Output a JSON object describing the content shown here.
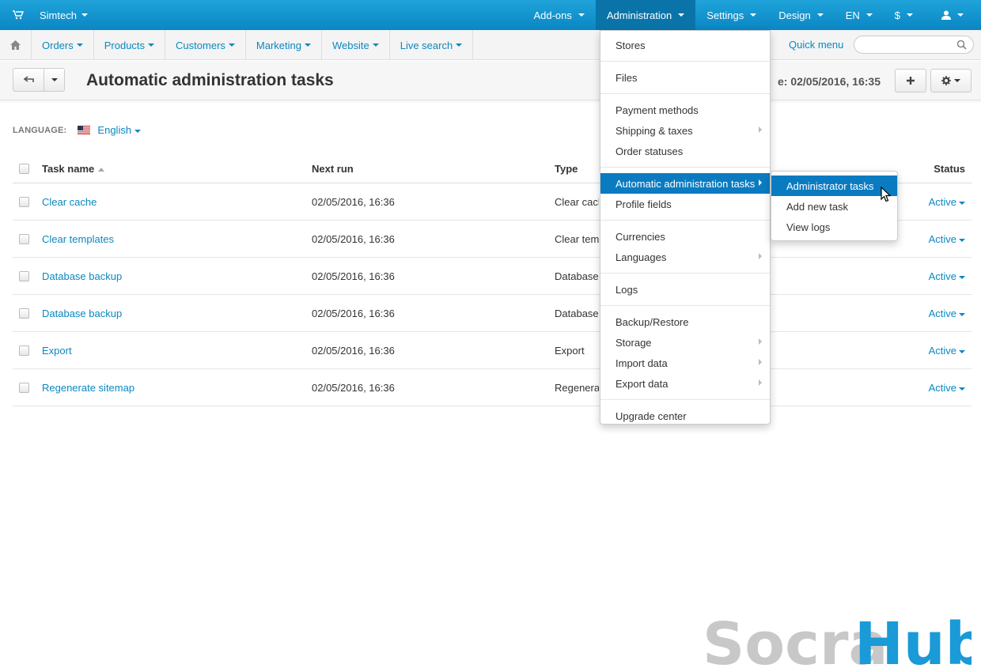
{
  "topbar": {
    "store_label": "Simtech",
    "nav": [
      "Add-ons",
      "Administration",
      "Settings",
      "Design",
      "EN",
      "$"
    ],
    "active_index": 1
  },
  "subnav": {
    "items": [
      "Orders",
      "Products",
      "Customers",
      "Marketing",
      "Website",
      "Live search"
    ],
    "quick_menu": "Quick menu",
    "search_placeholder": ""
  },
  "titlebar": {
    "title": "Automatic administration tasks",
    "current_time": "e: 02/05/2016, 16:35"
  },
  "language": {
    "label": "LANGUAGE:",
    "value": "English"
  },
  "table": {
    "headers": {
      "name": "Task name",
      "next_run": "Next run",
      "type": "Type",
      "status": "Status"
    },
    "rows": [
      {
        "name": "Clear cache",
        "next_run": "02/05/2016, 16:36",
        "type": "Clear cache",
        "status": "Active"
      },
      {
        "name": "Clear templates",
        "next_run": "02/05/2016, 16:36",
        "type": "Clear templates",
        "status": "Active"
      },
      {
        "name": "Database backup",
        "next_run": "02/05/2016, 16:36",
        "type": "Database backup",
        "status": "Active"
      },
      {
        "name": "Database backup",
        "next_run": "02/05/2016, 16:36",
        "type": "Database backup",
        "status": "Active"
      },
      {
        "name": "Export",
        "next_run": "02/05/2016, 16:36",
        "type": "Export",
        "status": "Active"
      },
      {
        "name": "Regenerate sitemap",
        "next_run": "02/05/2016, 16:36",
        "type": "Regenerate sitemap",
        "status": "Active"
      }
    ]
  },
  "admin_menu": {
    "groups": [
      [
        {
          "label": "Stores"
        }
      ],
      [
        {
          "label": "Files"
        }
      ],
      [
        {
          "label": "Payment methods"
        },
        {
          "label": "Shipping & taxes",
          "sub": true
        },
        {
          "label": "Order statuses"
        }
      ],
      [
        {
          "label": "Automatic administration tasks",
          "sub": true,
          "highlight": true
        },
        {
          "label": "Profile fields"
        }
      ],
      [
        {
          "label": "Currencies"
        },
        {
          "label": "Languages",
          "sub": true
        }
      ],
      [
        {
          "label": "Logs"
        }
      ],
      [
        {
          "label": "Backup/Restore"
        },
        {
          "label": "Storage",
          "sub": true
        },
        {
          "label": "Import data",
          "sub": true
        },
        {
          "label": "Export data",
          "sub": true
        }
      ],
      [
        {
          "label": "Upgrade center"
        }
      ]
    ]
  },
  "sub_menu": {
    "items": [
      {
        "label": "Administrator tasks",
        "highlight": true
      },
      {
        "label": "Add new task"
      },
      {
        "label": "View logs"
      }
    ]
  },
  "watermark": {
    "part1": "Socra",
    "part2": "Hub"
  },
  "colors": {
    "topbar": "#0a86c4",
    "active_nav": "#0a74a9",
    "link": "#0a88c0",
    "highlight": "#0a7bc1",
    "watermark_gray": "#c8c8c8",
    "watermark_blue": "#1a9ad6"
  }
}
